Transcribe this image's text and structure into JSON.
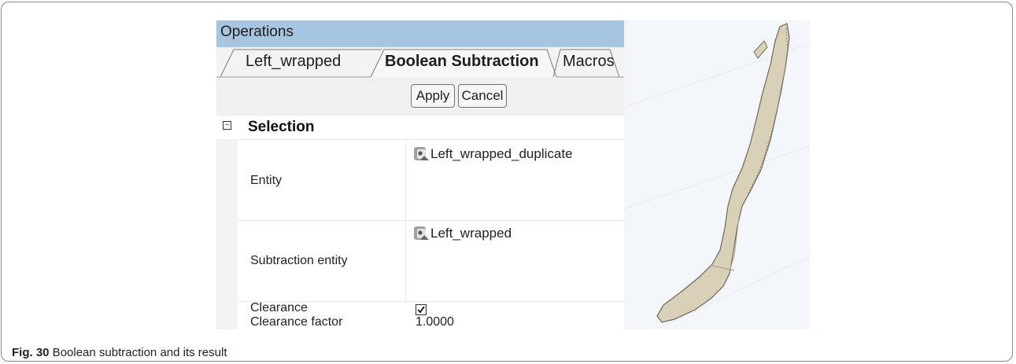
{
  "window": {
    "title": "Operations"
  },
  "tabs": [
    {
      "label": "Left_wrapped",
      "active": false
    },
    {
      "label": "Boolean Subtraction",
      "active": true
    },
    {
      "label": "Macros",
      "active": false
    }
  ],
  "actions": {
    "apply_label": "Apply",
    "cancel_label": "Cancel"
  },
  "properties": {
    "section_title": "Selection",
    "rows": {
      "entity": {
        "label": "Entity",
        "value": "Left_wrapped_duplicate",
        "icon": "mesh-entity-icon"
      },
      "subtraction_entity": {
        "label": "Subtraction entity",
        "value": "Left_wrapped",
        "icon": "mesh-entity-icon"
      },
      "clearance": {
        "label": "Clearance",
        "checked": true
      },
      "clearance_factor": {
        "label": "Clearance factor",
        "value": "1.0000"
      }
    }
  },
  "caption": {
    "label": "Fig. 30",
    "text": " Boolean subtraction and its result"
  },
  "colors": {
    "header": "#a7c4e0",
    "panel": "#f0f0f0",
    "model": "#d9d0b8",
    "viewport": "#f3f6fb"
  }
}
